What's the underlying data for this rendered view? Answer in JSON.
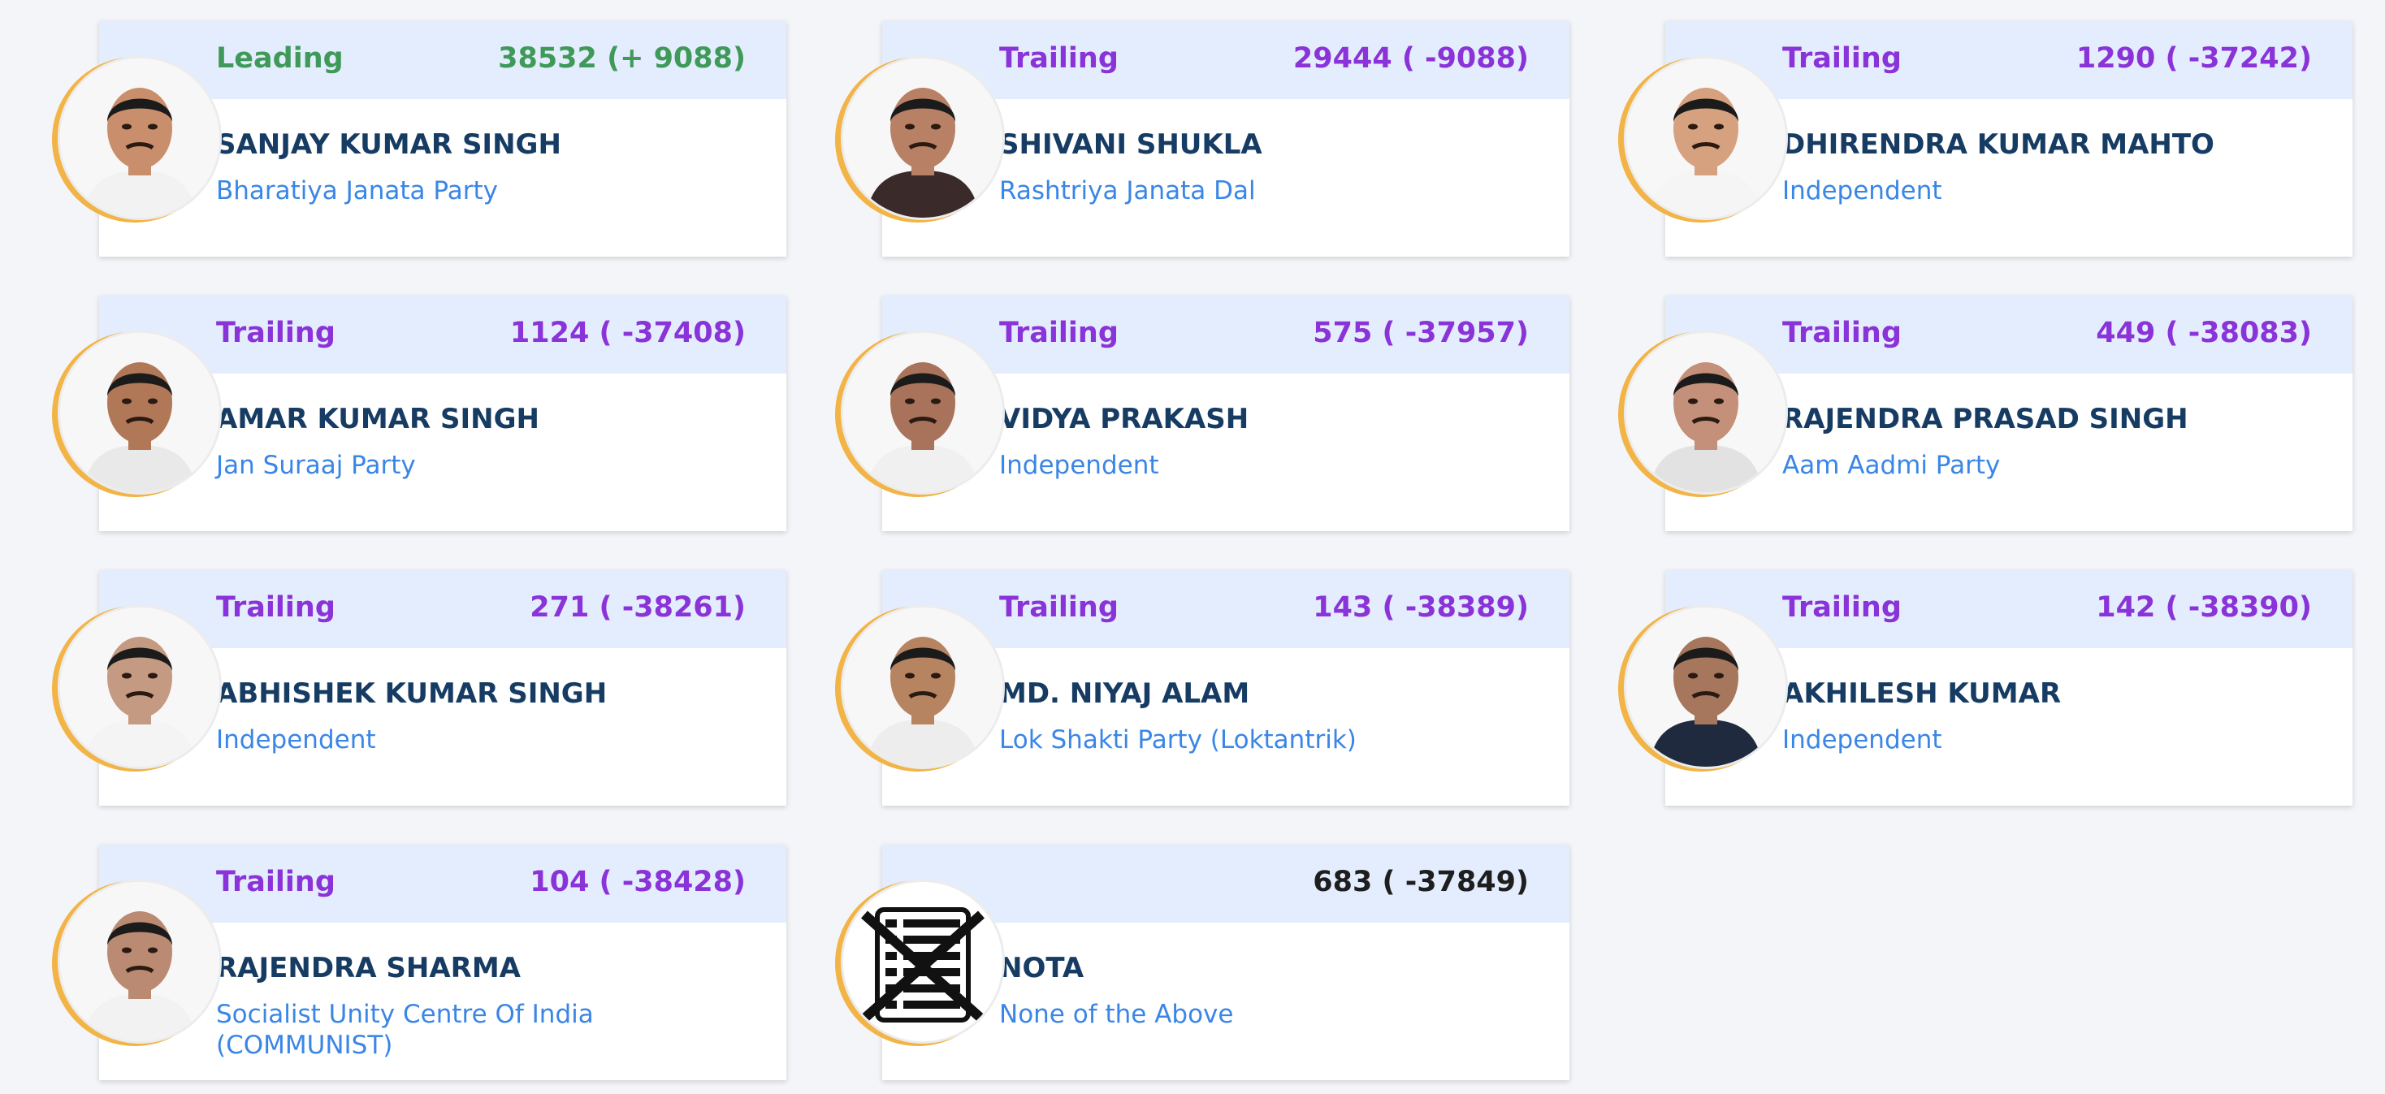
{
  "candidates": [
    {
      "status": "Leading",
      "votes": "38532 (+ 9088)",
      "name": "SANJAY KUMAR SINGH",
      "party": "Bharatiya Janata Party",
      "photo": "candidate-photo"
    },
    {
      "status": "Trailing",
      "votes": "29444 ( -9088)",
      "name": "SHIVANI SHUKLA",
      "party": "Rashtriya Janata Dal",
      "photo": "candidate-photo"
    },
    {
      "status": "Trailing",
      "votes": "1290 ( -37242)",
      "name": "DHIRENDRA KUMAR MAHTO",
      "party": "Independent",
      "photo": "candidate-photo"
    },
    {
      "status": "Trailing",
      "votes": "1124 ( -37408)",
      "name": "AMAR KUMAR SINGH",
      "party": "Jan Suraaj Party",
      "photo": "candidate-photo"
    },
    {
      "status": "Trailing",
      "votes": "575 ( -37957)",
      "name": "VIDYA PRAKASH",
      "party": "Independent",
      "photo": "candidate-photo"
    },
    {
      "status": "Trailing",
      "votes": "449 ( -38083)",
      "name": "RAJENDRA PRASAD SINGH",
      "party": "Aam Aadmi Party",
      "photo": "candidate-photo"
    },
    {
      "status": "Trailing",
      "votes": "271 ( -38261)",
      "name": "ABHISHEK KUMAR SINGH",
      "party": "Independent",
      "photo": "candidate-photo"
    },
    {
      "status": "Trailing",
      "votes": "143 ( -38389)",
      "name": "MD. NIYAJ ALAM",
      "party": "Lok Shakti Party (Loktantrik)",
      "photo": "candidate-photo"
    },
    {
      "status": "Trailing",
      "votes": "142 ( -38390)",
      "name": "AKHILESH KUMAR",
      "party": "Independent",
      "photo": "candidate-photo"
    },
    {
      "status": "Trailing",
      "votes": "104 ( -38428)",
      "name": "RAJENDRA SHARMA",
      "party": "Socialist Unity Centre Of India (COMMUNIST)",
      "photo": "candidate-photo"
    },
    {
      "status": "",
      "votes": "683 ( -37849)",
      "name": "NOTA",
      "party": "None of the Above",
      "photo": "nota-symbol-icon"
    }
  ],
  "colors": {
    "leading": "#3f9a59",
    "trailing": "#8a33d8",
    "name": "#173c63",
    "party": "#3a86e6",
    "header_bg": "#e4edfd",
    "ring": "#f2b446"
  }
}
